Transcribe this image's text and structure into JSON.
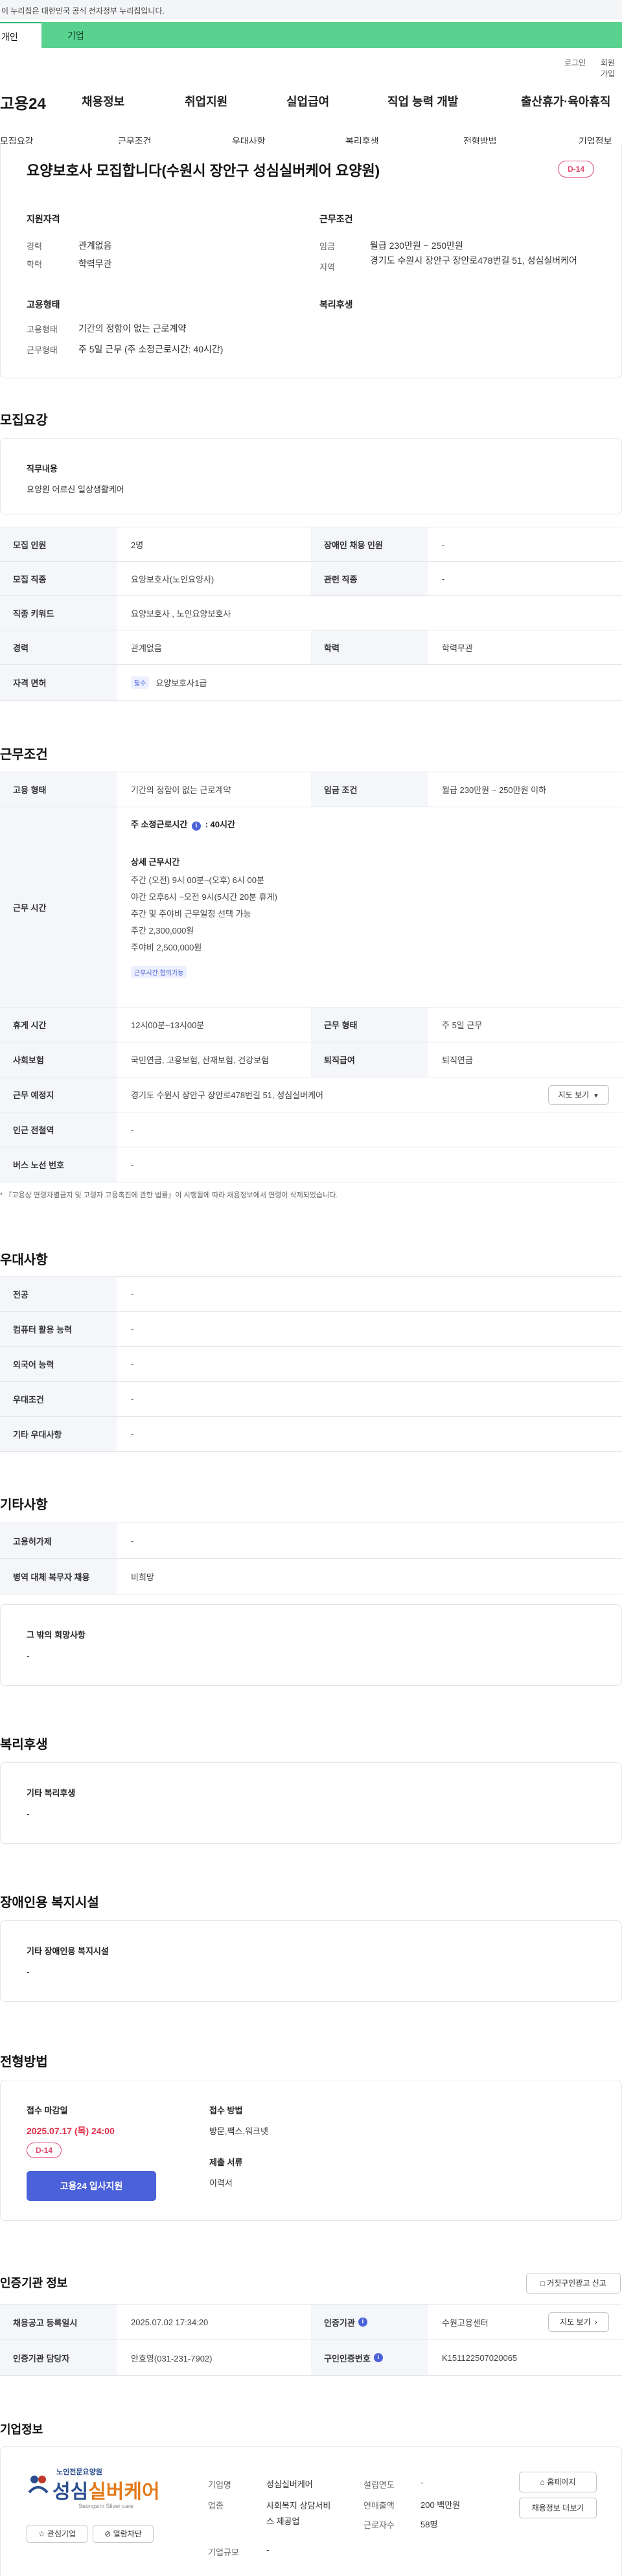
{
  "banner": {
    "text": "이 누리집은 대한민국 공식 전자정부 누리집입니다."
  },
  "topTabs": {
    "personal": "개인",
    "company": "기업"
  },
  "util": {
    "login": "로그인",
    "join": "회원가입"
  },
  "brand": {
    "logo": "고용24"
  },
  "nav": [
    "채용정보",
    "취업지원",
    "실업급여",
    "직업 능력 개발",
    "출산휴가·육아휴직"
  ],
  "subnav": [
    "모집요강",
    "근무조건",
    "우대사항",
    "복리후생",
    "전형방법",
    "기업정보"
  ],
  "job": {
    "title": "요양보호사 모집합니다(수원시 장안구 성심실버케어 요양원)",
    "dday": "D-14",
    "qualification": {
      "heading": "지원자격",
      "career_label": "경력",
      "career": "관계없음",
      "edu_label": "학력",
      "edu": "학력무관"
    },
    "conditions": {
      "heading": "근무조건",
      "wage_label": "임금",
      "wage": "월급 230만원 ~ 250만원",
      "region_label": "지역",
      "region": "경기도 수원시 장안구 장안로478번길 51, 성심실버케어"
    },
    "employment": {
      "heading": "고용형태",
      "type_label": "고용형태",
      "type": "기간의 정함이 없는 근로계약",
      "form_label": "근무형태",
      "form": "주 5일 근무 (주 소정근로시간: 40시간)"
    },
    "welfare": {
      "heading": "복리후생"
    }
  },
  "recruit": {
    "section": "모집요강",
    "duty_heading": "직무내용",
    "duty": "요양원 어르신 일상생활케어",
    "rows": [
      {
        "l1": "모집 인원",
        "v1": "2명",
        "l2": "장애인 채용 인원",
        "v2": "-"
      },
      {
        "l1": "모집 직종",
        "v1": "요양보호사(노인요양사)",
        "l2": "관련 직종",
        "v2": "-"
      },
      {
        "l1": "직종 키워드",
        "v1": "요양보호사 , 노인요양보호사"
      },
      {
        "l1": "경력",
        "v1": "관계없음",
        "l2": "학력",
        "v2": "학력무관"
      },
      {
        "l1": "자격 면허",
        "tag": "필수",
        "v1": "요양보호사1급"
      }
    ]
  },
  "work": {
    "section": "근무조건",
    "type_l": "고용 형태",
    "type_v": "기간의 정함이 없는 근로계약",
    "wage_l": "임금 조건",
    "wage_v": "월급 230만원 ~ 250만원 이하",
    "time_l": "근무 시간",
    "hours_title": "주 소정근로시간",
    "hours_value": ": 40시간",
    "detail_title": "상세 근무시간",
    "detail_lines": [
      "주간 (오전) 9시 00분~(오후) 6시 00분",
      "야간 오후6시 ~오전 9시(5시간 20분 휴게)",
      "주간 및 주야비 근무일정 선택 가능",
      "주간 2,300,000원",
      "주야비 2,500,000원"
    ],
    "flex_tag": "근무시간 협의가능",
    "break_l": "휴게 시간",
    "break_v": "12시00분~13시00분",
    "form_l": "근무 형태",
    "form_v": "주 5일 근무",
    "ins_l": "사회보험",
    "ins_v": "국민연금, 고용보험, 산재보험, 건강보험",
    "ret_l": "퇴직급여",
    "ret_v": "퇴직연금",
    "place_l": "근무 예정지",
    "place_v": "경기도 수원시 장안구 장안로478번길 51, 성심실버케어",
    "map_btn": "지도 보기",
    "station_l": "인근 전철역",
    "station_v": "-",
    "bus_l": "버스 노선 번호",
    "bus_v": "-",
    "note": "* 『고용상 연령차별금지 및 고령자 고용촉진에 관한 법률』이 시행됨에 따라 채용정보에서 연령이 삭제되었습니다."
  },
  "preference": {
    "section": "우대사항",
    "rows": [
      {
        "l": "전공",
        "v": "-"
      },
      {
        "l": "컴퓨터 활용 능력",
        "v": "-"
      },
      {
        "l": "외국어 능력",
        "v": "-"
      },
      {
        "l": "우대조건",
        "v": "-"
      },
      {
        "l": "기타 우대사항",
        "v": "-"
      }
    ]
  },
  "etc": {
    "section": "기타사항",
    "rows": [
      {
        "l": "고용허가제",
        "v": "-"
      },
      {
        "l": "병역 대체 복무자 채용",
        "v": "비희망"
      }
    ],
    "other_heading": "그 밖의 희망사항",
    "other_value": "-"
  },
  "welfare": {
    "section": "복리후생",
    "heading": "기타 복리후생",
    "value": "-"
  },
  "disability": {
    "section": "장애인용 복지시설",
    "heading": "기타 장애인용 복지시설",
    "value": "-"
  },
  "selection": {
    "section": "전형방법",
    "deadline_heading": "접수 마감일",
    "deadline": "2025.07.17 (목) 24:00",
    "dday": "D-14",
    "apply_btn": "고용24 입사지원",
    "method_heading": "접수 방법",
    "method": "방문,팩스,워크넷",
    "docs_heading": "제출 서류",
    "docs": "이력서"
  },
  "agency": {
    "section": "인증기관 정보",
    "report_btn": "거짓구인광고 신고",
    "reg_l": "채용공고 등록일시",
    "reg_v": "2025.07.02 17:34:20",
    "org_l": "인증기관",
    "org_v": "수원고용센터",
    "map_btn": "지도 보기",
    "mgr_l": "인증기관 담당자",
    "mgr_v": "안효영(031-231-7902)",
    "num_l": "구인인증번호",
    "num_v": "K151122507020065"
  },
  "company": {
    "section": "기업정보",
    "logo_top": "노인전문요양원",
    "logo_main_left": "성심",
    "logo_main_right": "실버케어",
    "logo_en": "Seongsim Silver care",
    "fav_btn": "관심기업",
    "block_btn": "열람차단",
    "name_l": "기업명",
    "name_v": "성심실버케어",
    "biz_l": "업종",
    "biz_v": "사회복지 상담서비스 제공업",
    "size_l": "기업규모",
    "size_v": "-",
    "year_l": "설립연도",
    "year_v": "-",
    "sales_l": "연매출액",
    "sales_v": "200 백만원",
    "emp_l": "근로자수",
    "emp_v": "58명",
    "home_btn": "홈페이지",
    "list_btn": "채용정보 더보기"
  },
  "colors": {
    "accent": "#4a61d9",
    "dday": "#e0466e",
    "green": "#59d290"
  }
}
